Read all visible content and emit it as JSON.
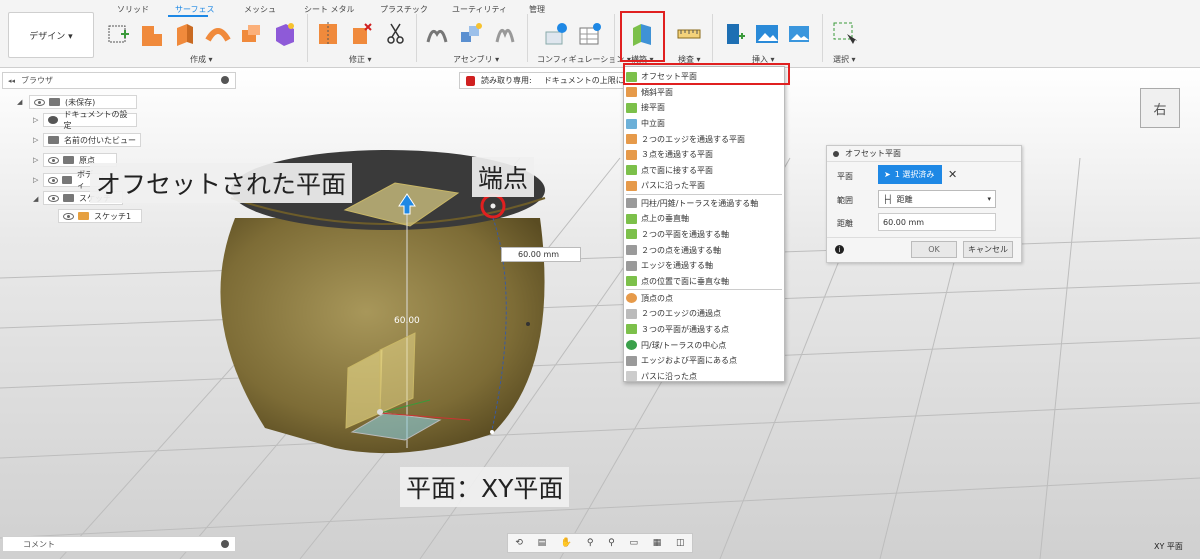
{
  "design_button": "デザイン ▾",
  "tabs": [
    "ソリッド",
    "サーフェス",
    "メッシュ",
    "シート メタル",
    "プラスチック",
    "ユーティリティ",
    "管理"
  ],
  "active_tab": "サーフェス",
  "groups": {
    "create": "作成 ▾",
    "modify": "修正 ▾",
    "assemble": "アセンブリ ▾",
    "configure": "コンフィギュレーション ▾",
    "construct": "構築 ▾",
    "inspect": "検査 ▾",
    "insert": "挿入 ▾",
    "select": "選択 ▾"
  },
  "browser": {
    "title": "ブラウザ",
    "root": "(未保存)",
    "items": [
      "ドキュメントの設定",
      "名前の付いたビュー",
      "原点",
      "ボディ",
      "スケッチ",
      "スケッチ1"
    ]
  },
  "readonly": {
    "label": "読み取り専用:",
    "message": "ドキュメントの上限に"
  },
  "construct_menu": [
    "オフセット平面",
    "傾斜平面",
    "接平面",
    "中立面",
    "２つのエッジを通過する平面",
    "３点を通過する平面",
    "点で面に接する平面",
    "パスに沿った平面",
    "円柱/円錐/トーラスを通過する軸",
    "点上の垂直軸",
    "２つの平面を通過する軸",
    "２つの点を通過する軸",
    "エッジを通過する軸",
    "点の位置で面に垂直な軸",
    "頂点の点",
    "２つのエッジの通過点",
    "３つの平面が通過する点",
    "円/球/トーラスの中心点",
    "エッジおよび平面にある点",
    "パスに沿った点"
  ],
  "dialog": {
    "title": "オフセット平面",
    "plane_label": "平面",
    "plane_value": "1 選択済み",
    "range_label": "範囲",
    "range_value": "距離",
    "distance_label": "距離",
    "distance_value": "60.00 mm",
    "ok": "OK",
    "cancel": "キャンセル"
  },
  "viewport": {
    "distance_input": "60.00 mm",
    "dimension_label": "60.00",
    "viewcube_label": "右",
    "plane_label": "XY 平面"
  },
  "callouts": {
    "offset_plane": "オフセットされた平面",
    "endpoint": "端点",
    "base_plane": "平面：XY平面"
  },
  "comment": "コメント",
  "colors": {
    "accent": "#1e88e5",
    "highlight": "#e02020",
    "body": "#8a7a44"
  }
}
